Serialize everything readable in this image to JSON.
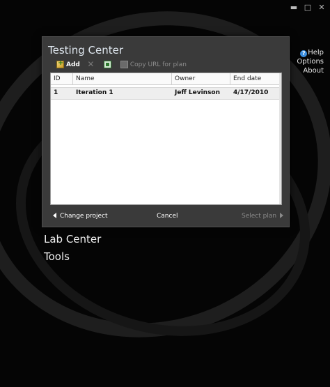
{
  "window_controls": {
    "minimize": "▬",
    "maximize": "□",
    "close": "✕"
  },
  "right_links": {
    "help": "Help",
    "options": "Options",
    "about": "About"
  },
  "dialog": {
    "title": "Testing Center",
    "toolbar": {
      "add": "Add",
      "copy_url": "Copy URL for plan"
    },
    "grid": {
      "columns": [
        "ID",
        "Name",
        "Owner",
        "End date"
      ],
      "rows": [
        {
          "id": "1",
          "name": "Iteration 1",
          "owner": "Jeff Levinson",
          "end_date": "4/17/2010"
        }
      ]
    },
    "footer": {
      "change_project": "Change project",
      "cancel": "Cancel",
      "select_plan": "Select plan"
    }
  },
  "nav": {
    "lab_center": "Lab Center",
    "tools": "Tools"
  },
  "colors": {
    "background": "#050505",
    "dialog": "#3a3a3a",
    "accent": "#3c8fe0"
  }
}
